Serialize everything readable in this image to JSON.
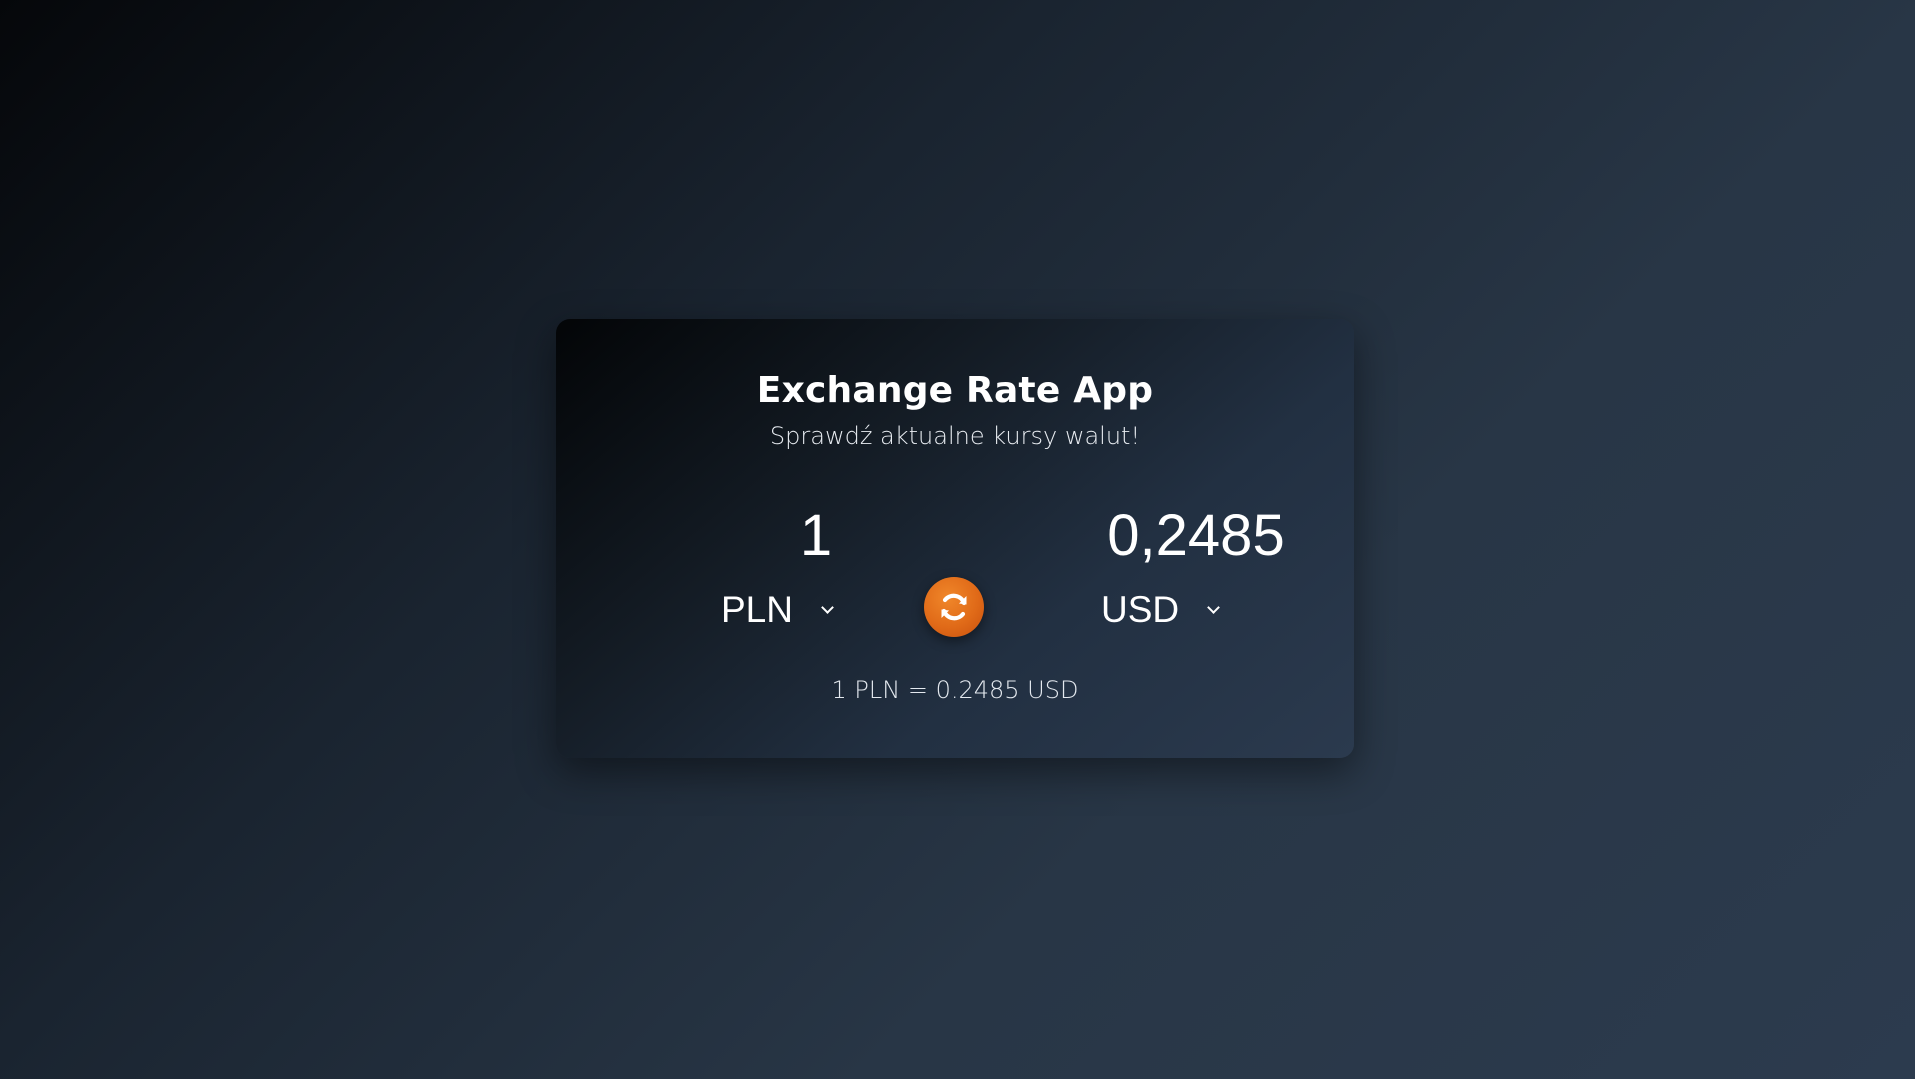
{
  "app": {
    "title": "Exchange Rate App",
    "subtitle": "Sprawdź aktualne kursy walut!"
  },
  "converter": {
    "from_amount": "1",
    "from_currency": "PLN",
    "to_amount": "0,2485",
    "to_currency": "USD",
    "rate_text": "1 PLN = 0.2485 USD"
  },
  "icons": {
    "swap": "refresh-icon",
    "dropdown": "chevron-down-icon"
  },
  "colors": {
    "accent": "#e06a18",
    "text": "#ffffff",
    "card_bg": "#1a2430"
  }
}
